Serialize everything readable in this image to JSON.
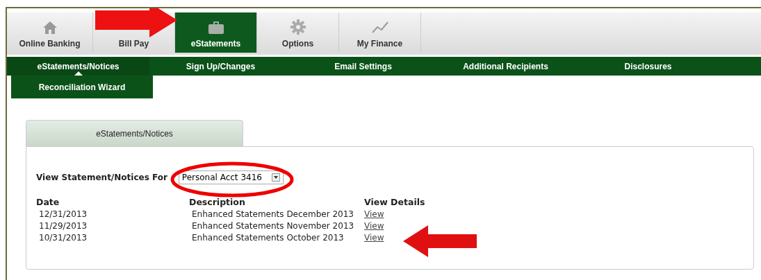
{
  "top_tabs": [
    {
      "label": "Online Banking",
      "selected": false
    },
    {
      "label": "Bill Pay",
      "selected": false
    },
    {
      "label": "eStatements",
      "selected": true
    },
    {
      "label": "Options",
      "selected": false
    },
    {
      "label": "My Finance",
      "selected": false
    }
  ],
  "nav": [
    {
      "label": "eStatements/Notices",
      "selected": true
    },
    {
      "label": "Sign Up/Changes",
      "selected": false
    },
    {
      "label": "Email Settings",
      "selected": false
    },
    {
      "label": "Additional Recipients",
      "selected": false
    },
    {
      "label": "Disclosures",
      "selected": false
    }
  ],
  "subnav": [
    {
      "label": "Reconciliation Wizard"
    }
  ],
  "panel": {
    "tab": "eStatements/Notices",
    "account_label": "View Statement/Notices For",
    "account_select": "Personal Acct 3416",
    "columns": [
      "Date",
      "Description",
      "View Details"
    ],
    "rows": [
      {
        "date": "12/31/2013",
        "description": "Enhanced Statements December 2013",
        "link": "View"
      },
      {
        "date": "11/29/2013",
        "description": "Enhanced Statements November 2013",
        "link": "View"
      },
      {
        "date": "10/31/2013",
        "description": "Enhanced Statements October 2013",
        "link": "View"
      }
    ]
  }
}
